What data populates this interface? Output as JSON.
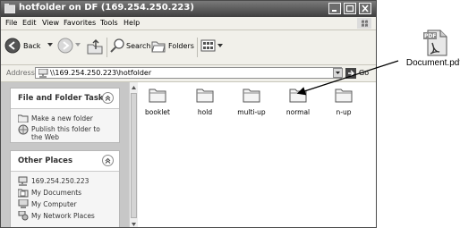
{
  "window": {
    "title": "hotfolder on DF (169.254.250.223)"
  },
  "menubar": {
    "items": [
      "File",
      "Edit",
      "View",
      "Favorites",
      "Tools",
      "Help"
    ]
  },
  "toolbar": {
    "back_label": "Back",
    "search_label": "Search",
    "folders_label": "Folders"
  },
  "addressbar": {
    "label": "Address",
    "path": "\\\\169.254.250.223\\hotfolder",
    "go_label": "Go"
  },
  "file_folder_tasks": {
    "header": "File and Folder Tasks",
    "items": [
      {
        "label": "Make a new folder",
        "icon": "new-folder-icon"
      },
      {
        "label": "Publish this folder to",
        "label2": "the Web",
        "icon": "publish-web-icon"
      }
    ]
  },
  "other_places": {
    "header": "Other Places",
    "items": [
      {
        "label": "169.254.250.223",
        "icon": "network-drive-icon"
      },
      {
        "label": "My Documents",
        "icon": "documents-icon"
      },
      {
        "label": "My Computer",
        "icon": "computer-icon"
      },
      {
        "label": "My Network Places",
        "icon": "network-places-icon"
      }
    ]
  },
  "folders": [
    {
      "name": "booklet"
    },
    {
      "name": "hold"
    },
    {
      "name": "multi-up"
    },
    {
      "name": "normal"
    },
    {
      "name": "n-up"
    }
  ],
  "document": {
    "filename": "Document.pdf",
    "badge": "PDF",
    "icon": "pdf-file-icon"
  }
}
